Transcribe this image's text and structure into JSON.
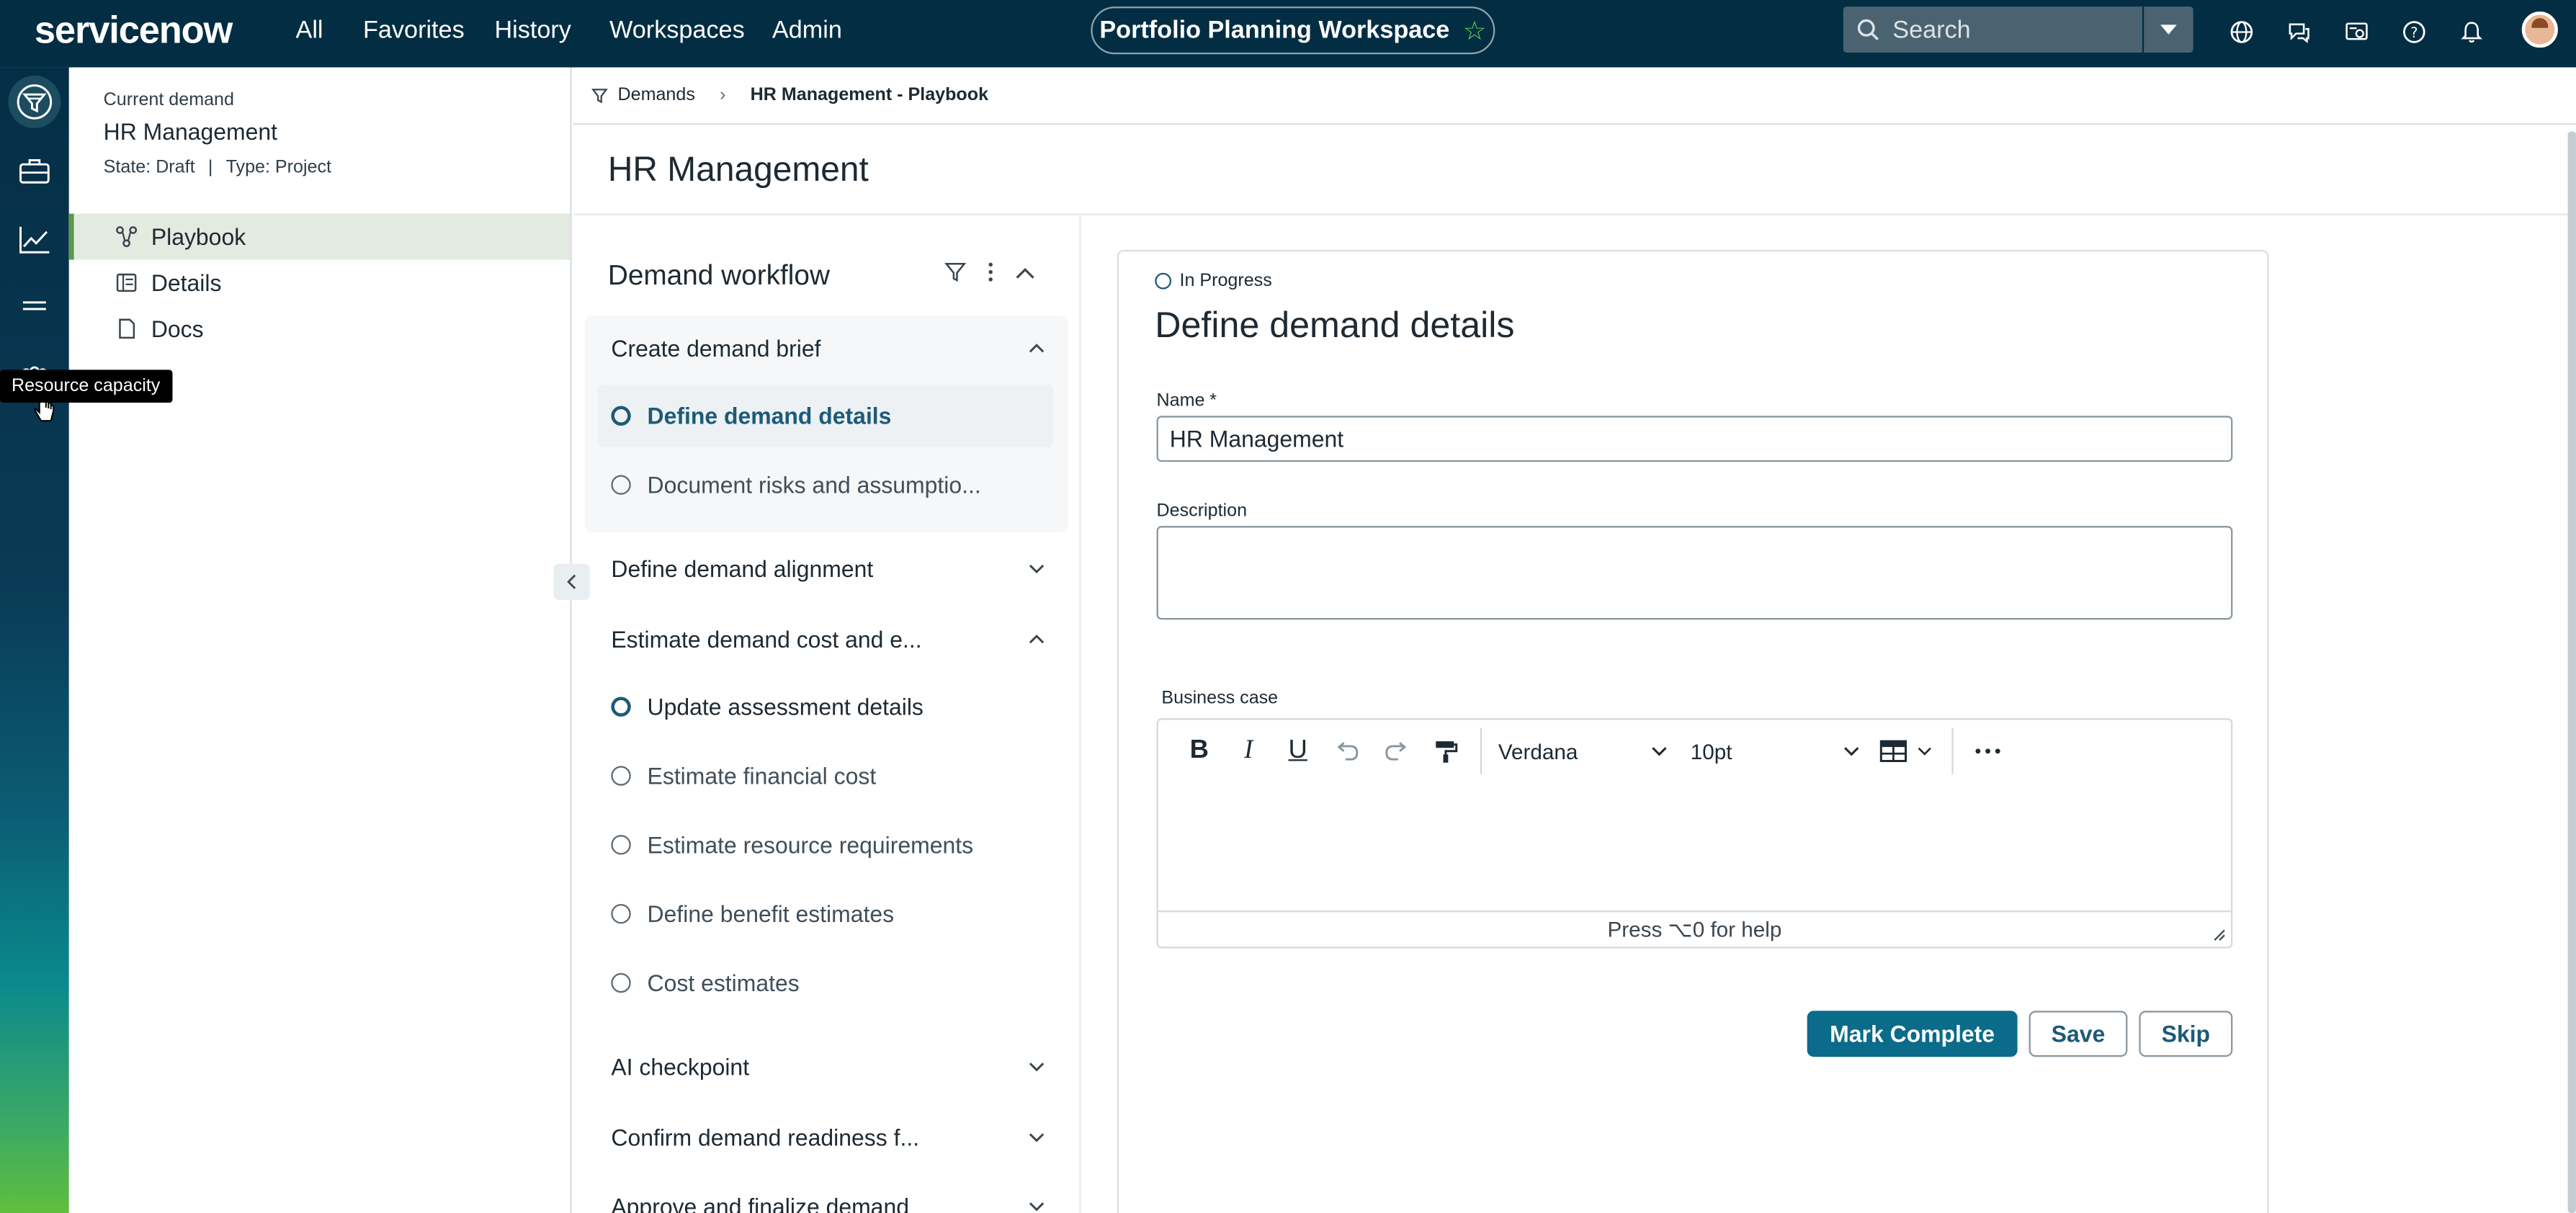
{
  "app": {
    "logo_text": "servicenow",
    "nav": [
      "All",
      "Favorites",
      "History",
      "Workspaces",
      "Admin"
    ],
    "workspace_pill": "Portfolio Planning Workspace",
    "search_placeholder": "Search",
    "accent_color": "#62d84e",
    "primary_color": "#0a6b8a"
  },
  "rail": {
    "tooltip": "Resource capacity",
    "icons": [
      "demand-funnel-icon",
      "briefcase-icon",
      "trend-chart-icon",
      "list-icon",
      "people-group-icon"
    ]
  },
  "context": {
    "label": "Current demand",
    "title": "HR Management",
    "state": "State:  Draft",
    "divider": "|",
    "type": "Type:  Project",
    "items": [
      {
        "label": "Playbook",
        "icon": "playbook-icon"
      },
      {
        "label": "Details",
        "icon": "details-icon"
      },
      {
        "label": "Docs",
        "icon": "docs-icon"
      }
    ]
  },
  "breadcrumb": {
    "root": "Demands",
    "current": "HR Management - Playbook"
  },
  "page": {
    "title": "HR Management"
  },
  "workflow": {
    "title": "Demand workflow",
    "stages": [
      {
        "label": "Create demand brief",
        "expanded": true
      },
      {
        "label": "Define demand alignment",
        "expanded": false
      },
      {
        "label": "Estimate demand cost and e...",
        "expanded": true
      },
      {
        "label": "AI checkpoint",
        "expanded": false
      },
      {
        "label": "Confirm demand readiness f...",
        "expanded": false
      },
      {
        "label": "Approve and finalize demand",
        "expanded": false
      }
    ],
    "brief_tasks": [
      "Define demand details",
      "Document risks and assumptio..."
    ],
    "estimate_tasks": [
      "Update assessment details",
      "Estimate financial cost",
      "Estimate resource requirements",
      "Define benefit estimates",
      "Cost estimates"
    ]
  },
  "task": {
    "status": "In Progress",
    "title": "Define demand details",
    "name_label": "Name",
    "required_mark": "*",
    "name_value": "HR Management",
    "description_label": "Description",
    "description_value": "",
    "business_case_label": "Business case",
    "font_value": "Verdana",
    "size_value": "10pt",
    "editor_help": "Press ⌥0 for help",
    "buttons": {
      "complete": "Mark Complete",
      "save": "Save",
      "skip": "Skip"
    }
  }
}
